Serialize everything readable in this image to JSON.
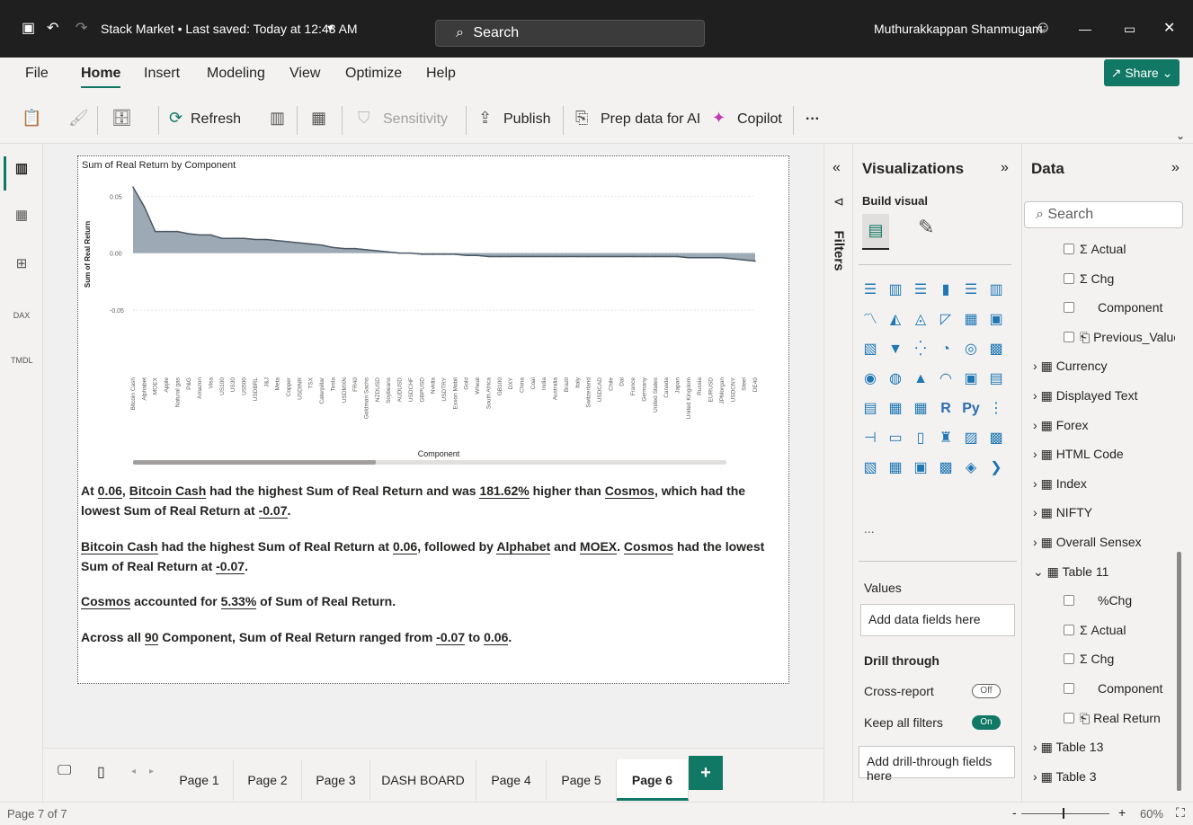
{
  "titlebar": {
    "doc_title": "Stack Market • Last saved: Today at 12:43 AM",
    "search_label": "Search",
    "user_name": "Muthurakkappan Shanmugam"
  },
  "menu": {
    "items": [
      "File",
      "Home",
      "Insert",
      "Modeling",
      "View",
      "Optimize",
      "Help"
    ],
    "share_label": "Share"
  },
  "ribbon": {
    "refresh": "Refresh",
    "sensitivity": "Sensitivity",
    "publish": "Publish",
    "prep_data": "Prep data for AI",
    "copilot": "Copilot",
    "more": "···"
  },
  "left_rail": {
    "dax_label": "DAX",
    "tmdl_label": "TMDL"
  },
  "chart_data": {
    "type": "area",
    "title": "Sum of Real Return by Component",
    "xlabel": "Component",
    "ylabel": "Sum of Real Return",
    "ylim": [
      -0.08,
      0.07
    ],
    "y_ticks": [
      "0.05",
      "0.00",
      "-0.05"
    ],
    "color": "#8c9aa7",
    "categories": [
      "Bitcoin Cash",
      "Alphabet",
      "MOEX",
      "Apple",
      "Natural gas",
      "P&G",
      "Amazon",
      "Visa",
      "US100",
      "US30",
      "US500",
      "USDBRL",
      "J&J",
      "Meta",
      "Copper",
      "USDINR",
      "TSX",
      "Caterpillar",
      "Tesla",
      "USDMXN",
      "FR40",
      "Goldman Sachs",
      "NZDUSD",
      "Soybeans",
      "AUDUSD",
      "USDCHF",
      "GBPUSD",
      "Nvidia",
      "USDTRY",
      "Exxon Mobil",
      "Gold",
      "Wheat",
      "South Africa",
      "GB100",
      "DXY",
      "China",
      "Coal",
      "India",
      "Australia",
      "Brazil",
      "Italy",
      "Switzerland",
      "USDCAD",
      "Chile",
      "Dai",
      "France",
      "Germany",
      "United States",
      "Canada",
      "Japan",
      "United Kingdom",
      "Russia",
      "EURUSD",
      "JPMorgan",
      "USDCNY",
      "Steel",
      "DE40"
    ],
    "values": [
      0.058,
      0.041,
      0.019,
      0.019,
      0.019,
      0.017,
      0.016,
      0.016,
      0.013,
      0.013,
      0.013,
      0.012,
      0.012,
      0.011,
      0.01,
      0.009,
      0.008,
      0.007,
      0.005,
      0.004,
      0.004,
      0.003,
      0.002,
      0.001,
      0.0,
      0.0,
      -0.001,
      -0.001,
      -0.001,
      -0.001,
      -0.002,
      -0.002,
      -0.003,
      -0.003,
      -0.003,
      -0.003,
      -0.003,
      -0.003,
      -0.003,
      -0.003,
      -0.003,
      -0.003,
      -0.003,
      -0.003,
      -0.003,
      -0.003,
      -0.003,
      -0.003,
      -0.003,
      -0.003,
      -0.004,
      -0.004,
      -0.004,
      -0.004,
      -0.005,
      -0.006,
      -0.007
    ]
  },
  "narratives": {
    "p1": {
      "a": "At ",
      "v1": "0.06",
      "b": ", ",
      "v2": "Bitcoin Cash",
      "c": " had the highest Sum of Real Return and was ",
      "v3": "181.62%",
      "d": " higher than ",
      "v4": "Cosmos",
      "e": ", which had the lowest Sum of Real Return at ",
      "v5": "-0.07",
      "f": "."
    },
    "p2": {
      "v1": "Bitcoin Cash",
      "a": " had the highest Sum of Real Return at ",
      "v2": "0.06",
      "b": ", followed by ",
      "v3": "Alphabet",
      "c": " and ",
      "v4": "MOEX",
      "d": ". ",
      "v5": "Cosmos",
      "e": " had the lowest Sum of Real Return at ",
      "v6": "-0.07",
      "f": "."
    },
    "p3": {
      "v1": "Cosmos",
      "a": " accounted for ",
      "v2": "5.33%",
      "b": " of Sum of Real Return."
    },
    "p4": {
      "a": "Across all ",
      "v1": "90",
      "b": " Component, Sum of Real Return ranged from ",
      "v2": "-0.07",
      "c": " to ",
      "v3": "0.06",
      "d": "."
    }
  },
  "filters": {
    "label": "Filters"
  },
  "visualizations": {
    "title": "Visualizations",
    "build_visual": "Build visual",
    "more": "...",
    "values_label": "Values",
    "add_fields": "Add data fields here",
    "drill_through": "Drill through",
    "cross_report": "Cross-report",
    "cross_report_state": "Off",
    "keep_filters": "Keep all filters",
    "keep_filters_state": "On",
    "add_drill": "Add drill-through fields here"
  },
  "data_pane": {
    "title": "Data",
    "search_placeholder": "Search",
    "items": [
      {
        "label": "Actual",
        "prefix": "Σ",
        "level": 2
      },
      {
        "label": "Chg",
        "prefix": "Σ",
        "level": 2
      },
      {
        "label": "Component",
        "prefix": "",
        "level": 2
      },
      {
        "label": "Previous_Value",
        "prefix": "",
        "level": 2
      },
      {
        "label": "Currency",
        "prefix": "table",
        "level": 1
      },
      {
        "label": "Displayed Text",
        "prefix": "table",
        "level": 1
      },
      {
        "label": "Forex",
        "prefix": "table",
        "level": 1
      },
      {
        "label": "HTML Code",
        "prefix": "table",
        "level": 1
      },
      {
        "label": "Index",
        "prefix": "table",
        "level": 1
      },
      {
        "label": "NIFTY",
        "prefix": "table",
        "level": 1
      },
      {
        "label": "Overall Sensex",
        "prefix": "table",
        "level": 1
      },
      {
        "label": "Table 11",
        "prefix": "table-open",
        "level": 1
      },
      {
        "label": "%Chg",
        "prefix": "",
        "level": 2
      },
      {
        "label": "Actual",
        "prefix": "Σ",
        "level": 2
      },
      {
        "label": "Chg",
        "prefix": "Σ",
        "level": 2
      },
      {
        "label": "Component",
        "prefix": "",
        "level": 2
      },
      {
        "label": "Real Return",
        "prefix": "",
        "level": 2
      },
      {
        "label": "Table 13",
        "prefix": "table",
        "level": 1
      },
      {
        "label": "Table 3",
        "prefix": "table",
        "level": 1
      }
    ]
  },
  "pages": {
    "tabs": [
      "Page 1",
      "Page 2",
      "Page 3",
      "DASH BOARD",
      "Page 4",
      "Page 5",
      "Page 6"
    ],
    "active": "Page 6",
    "add": "+"
  },
  "status": {
    "page_indicator": "Page 7 of 7",
    "zoom": "60%"
  }
}
